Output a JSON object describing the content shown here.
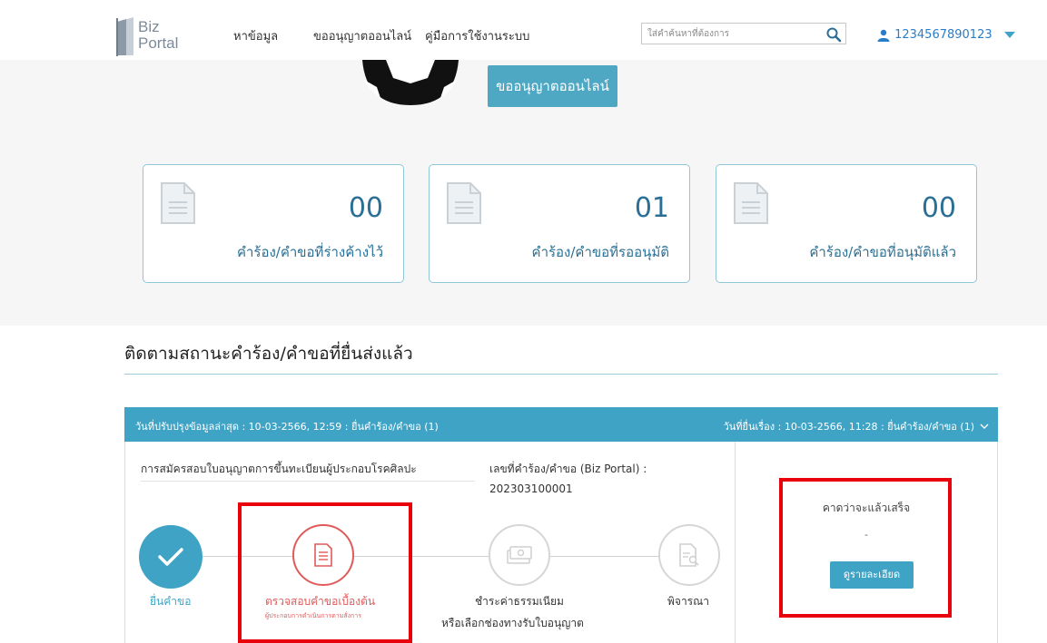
{
  "header": {
    "logo_line1": "Biz",
    "logo_line2": "Portal",
    "nav": [
      {
        "label": "หาข้อมูล"
      },
      {
        "label": "ขออนุญาตออนไลน์"
      },
      {
        "label": "คู่มือการใช้งานระบบ"
      }
    ],
    "search_placeholder": "ใส่คำค้นหาที่ต้องการ",
    "search_icon": "search-icon",
    "user_icon": "user-icon",
    "username": "1234567890123",
    "dropdown_icon": "caret-down-icon"
  },
  "hero": {
    "button_label": "ขออนุญาตออนไลน์"
  },
  "stats": [
    {
      "count": "00",
      "label": "คำร้อง/คำขอที่ร่างค้างไว้",
      "icon": "document-icon"
    },
    {
      "count": "01",
      "label": "คำร้อง/คำขอที่รออนุมัติ",
      "icon": "document-icon"
    },
    {
      "count": "00",
      "label": "คำร้อง/คำขอที่อนุมัติแล้ว",
      "icon": "document-icon"
    }
  ],
  "tracking": {
    "title": "ติดตามสถานะคำร้อง/คำขอที่ยื่นส่งแล้ว",
    "card": {
      "header_left": "วันที่ปรับปรุงข้อมูลล่าสุด : 10-03-2566, 12:59 : ยื่นคำร้อง/คำขอ (1)",
      "header_right": "วันที่ยื่นเรื่อง : 10-03-2566, 11:28 : ยื่นคำร้อง/คำขอ (1)",
      "request_name": "การสมัครสอบใบอนุญาตการขึ้นทะเบียนผู้ประกอบโรคศิลปะ",
      "request_no_label": "เลขที่คำร้อง/คำขอ (Biz Portal) :",
      "request_no": "202303100001",
      "steps": [
        {
          "label": "ยื่นคำขอ",
          "icon": "check-icon",
          "status": "done"
        },
        {
          "label": "ตรวจสอบคำขอเบื้องต้น",
          "sublabel": "ผู้ประกอบการดำเนินการตามสั่งการ",
          "icon": "document-list-icon",
          "status": "current"
        },
        {
          "label": "ชำระค่าธรรมเนียม",
          "label2": "หรือเลือกช่องทางรับใบอนุญาต",
          "icon": "money-icon",
          "status": "pending"
        },
        {
          "label": "พิจารณา",
          "icon": "document-review-icon",
          "status": "pending"
        }
      ],
      "estimate_label": "คาดว่าจะแล้วเสร็จ",
      "estimate_value": "-",
      "detail_button": "ดูรายละเอียด"
    }
  },
  "colors": {
    "accent": "#3fa3c6",
    "hero_button": "#4ea7c3",
    "stat_text": "#2a6f95",
    "current_step": "#e05a5a",
    "annotation_red": "#e8000b"
  }
}
